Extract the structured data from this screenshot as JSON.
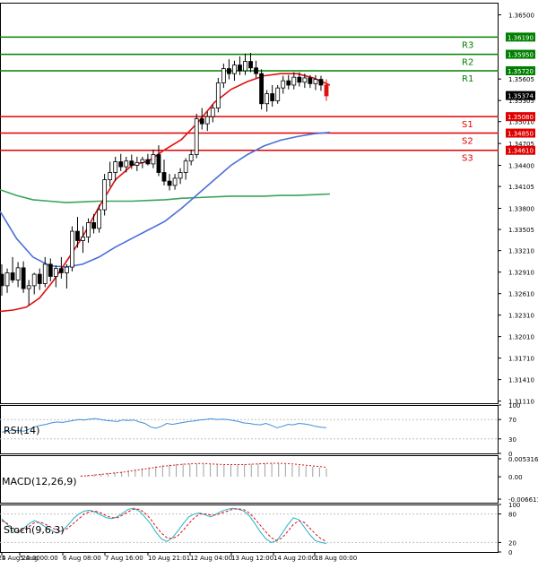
{
  "chart_data": [
    {
      "type": "candlestick",
      "panel": "price",
      "y_ticks": [
        "1.36500",
        "1.35605",
        "1.35305",
        "1.35010",
        "1.34705",
        "1.34400",
        "1.34105",
        "1.33800",
        "1.33505",
        "1.33210",
        "1.32910",
        "1.32610",
        "1.32310",
        "1.32010",
        "1.31710",
        "1.31410",
        "1.31110"
      ],
      "ylim": [
        1.3108,
        1.3667
      ],
      "price_labels": [
        {
          "value": 1.3619,
          "text": "1.36190",
          "color": "#008000"
        },
        {
          "value": 1.3595,
          "text": "1.35950",
          "color": "#008000"
        },
        {
          "value": 1.3572,
          "text": "1.35720",
          "color": "#008000"
        },
        {
          "value": 1.35374,
          "text": "1.35374",
          "color": "#000000"
        },
        {
          "value": 1.3508,
          "text": "1.35080",
          "color": "#e00000"
        },
        {
          "value": 1.3485,
          "text": "1.34850",
          "color": "#e00000"
        },
        {
          "value": 1.3461,
          "text": "1.34610",
          "color": "#e00000"
        }
      ],
      "levels": [
        {
          "name": "R3",
          "value": 1.3619,
          "color": "#008000"
        },
        {
          "name": "R2",
          "value": 1.3595,
          "color": "#008000"
        },
        {
          "name": "R1",
          "value": 1.3572,
          "color": "#008000"
        },
        {
          "name": "S1",
          "value": 1.3508,
          "color": "#e00000"
        },
        {
          "name": "S2",
          "value": 1.3485,
          "color": "#e00000"
        },
        {
          "name": "S3",
          "value": 1.3461,
          "color": "#e00000"
        }
      ],
      "candles": [
        [
          1.3288,
          1.3302,
          1.3258,
          1.3272
        ],
        [
          1.3272,
          1.3296,
          1.3262,
          1.329
        ],
        [
          1.329,
          1.3312,
          1.3276,
          1.328
        ],
        [
          1.328,
          1.3305,
          1.327,
          1.3297
        ],
        [
          1.3297,
          1.3306,
          1.3262,
          1.3268
        ],
        [
          1.3268,
          1.328,
          1.3245,
          1.3272
        ],
        [
          1.3272,
          1.329,
          1.326,
          1.3288
        ],
        [
          1.3288,
          1.3296,
          1.3266,
          1.3275
        ],
        [
          1.3275,
          1.3312,
          1.327,
          1.3302
        ],
        [
          1.3302,
          1.331,
          1.3278,
          1.3285
        ],
        [
          1.3285,
          1.33,
          1.327,
          1.3296
        ],
        [
          1.3296,
          1.3312,
          1.3282,
          1.329
        ],
        [
          1.329,
          1.3302,
          1.3268,
          1.3298
        ],
        [
          1.3298,
          1.3355,
          1.3292,
          1.3348
        ],
        [
          1.3348,
          1.3368,
          1.3325,
          1.3335
        ],
        [
          1.3335,
          1.3355,
          1.3318,
          1.334
        ],
        [
          1.334,
          1.3366,
          1.3332,
          1.336
        ],
        [
          1.336,
          1.3372,
          1.3345,
          1.3352
        ],
        [
          1.3352,
          1.3385,
          1.3346,
          1.3378
        ],
        [
          1.3378,
          1.3428,
          1.337,
          1.342
        ],
        [
          1.342,
          1.3445,
          1.341,
          1.343
        ],
        [
          1.343,
          1.3452,
          1.3418,
          1.3445
        ],
        [
          1.3445,
          1.3456,
          1.3432,
          1.3438
        ],
        [
          1.3438,
          1.3452,
          1.343,
          1.3446
        ],
        [
          1.3446,
          1.3455,
          1.3435,
          1.344
        ],
        [
          1.344,
          1.3452,
          1.3432,
          1.3444
        ],
        [
          1.3444,
          1.3452,
          1.3436,
          1.3448
        ],
        [
          1.3448,
          1.3456,
          1.344,
          1.3442
        ],
        [
          1.3442,
          1.3462,
          1.3436,
          1.3455
        ],
        [
          1.3455,
          1.3468,
          1.3425,
          1.343
        ],
        [
          1.343,
          1.3448,
          1.3412,
          1.3418
        ],
        [
          1.3418,
          1.3428,
          1.3405,
          1.3412
        ],
        [
          1.3412,
          1.3428,
          1.3406,
          1.3422
        ],
        [
          1.3422,
          1.3436,
          1.3414,
          1.343
        ],
        [
          1.343,
          1.345,
          1.342,
          1.3446
        ],
        [
          1.3446,
          1.3462,
          1.344,
          1.3455
        ],
        [
          1.3455,
          1.3512,
          1.345,
          1.3505
        ],
        [
          1.3505,
          1.352,
          1.349,
          1.3498
        ],
        [
          1.3498,
          1.3515,
          1.3488,
          1.3508
        ],
        [
          1.3508,
          1.3525,
          1.35,
          1.352
        ],
        [
          1.352,
          1.3562,
          1.3514,
          1.3555
        ],
        [
          1.3555,
          1.3582,
          1.3548,
          1.3575
        ],
        [
          1.3575,
          1.3588,
          1.356,
          1.3568
        ],
        [
          1.3568,
          1.3586,
          1.3558,
          1.358
        ],
        [
          1.358,
          1.3592,
          1.3566,
          1.3572
        ],
        [
          1.3572,
          1.3596,
          1.3566,
          1.3585
        ],
        [
          1.3585,
          1.3597,
          1.357,
          1.3576
        ],
        [
          1.3576,
          1.3586,
          1.3562,
          1.3568
        ],
        [
          1.3568,
          1.3574,
          1.3518,
          1.3526
        ],
        [
          1.3526,
          1.3545,
          1.3515,
          1.354
        ],
        [
          1.354,
          1.3552,
          1.3522,
          1.353
        ],
        [
          1.353,
          1.3552,
          1.3526,
          1.3548
        ],
        [
          1.3548,
          1.3565,
          1.354,
          1.3558
        ],
        [
          1.3558,
          1.3566,
          1.3546,
          1.3552
        ],
        [
          1.3552,
          1.357,
          1.3546,
          1.3563
        ],
        [
          1.3563,
          1.357,
          1.355,
          1.3556
        ],
        [
          1.3556,
          1.3568,
          1.3548,
          1.3562
        ],
        [
          1.3562,
          1.3566,
          1.3548,
          1.3554
        ],
        [
          1.3554,
          1.3566,
          1.3545,
          1.356
        ],
        [
          1.356,
          1.3565,
          1.3544,
          1.3552
        ],
        [
          1.3552,
          1.356,
          1.353,
          1.3537
        ]
      ],
      "ma_red": [
        [
          0,
          1.3236
        ],
        [
          0.04,
          1.3238
        ],
        [
          0.08,
          1.3242
        ],
        [
          0.12,
          1.3255
        ],
        [
          0.16,
          1.3278
        ],
        [
          0.2,
          1.3305
        ],
        [
          0.25,
          1.334
        ],
        [
          0.3,
          1.3382
        ],
        [
          0.35,
          1.342
        ],
        [
          0.4,
          1.344
        ],
        [
          0.45,
          1.3446
        ],
        [
          0.5,
          1.3462
        ],
        [
          0.55,
          1.3476
        ],
        [
          0.6,
          1.35
        ],
        [
          0.65,
          1.3528
        ],
        [
          0.7,
          1.3546
        ],
        [
          0.75,
          1.3557
        ],
        [
          0.8,
          1.3565
        ],
        [
          0.85,
          1.3568
        ],
        [
          0.9,
          1.3568
        ],
        [
          0.95,
          1.3562
        ],
        [
          1,
          1.3552
        ]
      ],
      "ma_blue": [
        [
          0,
          1.3376
        ],
        [
          0.05,
          1.3338
        ],
        [
          0.1,
          1.3312
        ],
        [
          0.15,
          1.33
        ],
        [
          0.2,
          1.3298
        ],
        [
          0.25,
          1.3302
        ],
        [
          0.3,
          1.3312
        ],
        [
          0.35,
          1.3326
        ],
        [
          0.4,
          1.3338
        ],
        [
          0.45,
          1.335
        ],
        [
          0.5,
          1.3362
        ],
        [
          0.55,
          1.338
        ],
        [
          0.6,
          1.34
        ],
        [
          0.65,
          1.342
        ],
        [
          0.7,
          1.344
        ],
        [
          0.75,
          1.3455
        ],
        [
          0.8,
          1.3467
        ],
        [
          0.85,
          1.3475
        ],
        [
          0.9,
          1.348
        ],
        [
          0.95,
          1.3484
        ],
        [
          1,
          1.3486
        ]
      ],
      "ma_green": [
        [
          0,
          1.3406
        ],
        [
          0.05,
          1.3398
        ],
        [
          0.1,
          1.3392
        ],
        [
          0.15,
          1.339
        ],
        [
          0.2,
          1.3388
        ],
        [
          0.25,
          1.3389
        ],
        [
          0.3,
          1.339
        ],
        [
          0.35,
          1.339
        ],
        [
          0.4,
          1.339
        ],
        [
          0.45,
          1.3391
        ],
        [
          0.5,
          1.3392
        ],
        [
          0.55,
          1.3394
        ],
        [
          0.6,
          1.3395
        ],
        [
          0.65,
          1.3396
        ],
        [
          0.7,
          1.3397
        ],
        [
          0.75,
          1.3397
        ],
        [
          0.8,
          1.3397
        ],
        [
          0.85,
          1.3398
        ],
        [
          0.9,
          1.3398
        ],
        [
          0.95,
          1.3399
        ],
        [
          1,
          1.34
        ]
      ]
    },
    {
      "type": "line",
      "panel": "rsi",
      "label": "RSI(14)",
      "y_ticks": [
        "100",
        "70",
        "30",
        "0"
      ],
      "ylim": [
        0,
        100
      ],
      "values": [
        44,
        46,
        48,
        47,
        46,
        50,
        55,
        58,
        60,
        63,
        65,
        64,
        66,
        68,
        70,
        69,
        71,
        72,
        70,
        68,
        67,
        66,
        69,
        68,
        69,
        65,
        62,
        55,
        52,
        56,
        62,
        60,
        62,
        64,
        66,
        67,
        69,
        70,
        72,
        70,
        71,
        70,
        68,
        66,
        63,
        62,
        60,
        59,
        62,
        58,
        53,
        56,
        60,
        59,
        62,
        61,
        59,
        56,
        54,
        53
      ]
    },
    {
      "type": "histogram",
      "panel": "macd",
      "label": "MACD(12,26,9)",
      "y_ticks": [
        "0.005316",
        "0.00",
        "-0.006611"
      ],
      "ylim": [
        -0.006611,
        0.005316
      ],
      "histogram": [
        0.0003,
        0.0005,
        0.0007,
        0.0009,
        0.0011,
        0.0013,
        0.0016,
        0.0019,
        0.0022,
        0.0025,
        0.0028,
        0.0031,
        0.0034,
        0.0036,
        0.0038,
        0.0039,
        0.0039,
        0.0039,
        0.0038,
        0.0037,
        0.0036,
        0.0035,
        0.0035,
        0.0036,
        0.0037,
        0.0038,
        0.0039,
        0.004,
        0.004,
        0.0039,
        0.0037,
        0.0035,
        0.0033,
        0.0031,
        0.0029,
        0.0027,
        0.0025
      ],
      "signal": [
        0.0002,
        0.0003,
        0.0005,
        0.0007,
        0.0009,
        0.0011,
        0.0013,
        0.0016,
        0.0019,
        0.0022,
        0.0025,
        0.0028,
        0.0031,
        0.0033,
        0.0035,
        0.0037,
        0.0038,
        0.0039,
        0.0039,
        0.0038,
        0.0037,
        0.0036,
        0.0036,
        0.0036,
        0.0036,
        0.0037,
        0.0038,
        0.0039,
        0.004,
        0.004,
        0.0039,
        0.0038,
        0.0036,
        0.0034,
        0.0032,
        0.003,
        0.0028
      ]
    },
    {
      "type": "line",
      "panel": "stoch",
      "label": "Stoch(9,6,3)",
      "y_ticks": [
        "100",
        "80",
        "20",
        "0"
      ],
      "ylim": [
        0,
        100
      ],
      "k": [
        70,
        58,
        44,
        40,
        50,
        60,
        66,
        60,
        52,
        46,
        40,
        45,
        56,
        70,
        80,
        86,
        88,
        84,
        78,
        72,
        70,
        74,
        82,
        90,
        92,
        86,
        74,
        60,
        42,
        28,
        22,
        30,
        44,
        60,
        74,
        80,
        82,
        78,
        74,
        80,
        86,
        90,
        92,
        90,
        86,
        76,
        60,
        42,
        28,
        20,
        24,
        40,
        58,
        72,
        68,
        52,
        36,
        24,
        20,
        18
      ],
      "d": [
        66,
        60,
        50,
        44,
        46,
        54,
        62,
        63,
        58,
        52,
        46,
        44,
        50,
        60,
        70,
        80,
        85,
        86,
        82,
        76,
        72,
        72,
        78,
        85,
        90,
        90,
        82,
        70,
        54,
        40,
        30,
        28,
        34,
        46,
        60,
        72,
        80,
        80,
        78,
        78,
        82,
        86,
        90,
        91,
        89,
        82,
        70,
        56,
        42,
        30,
        24,
        30,
        44,
        58,
        66,
        62,
        50,
        38,
        28,
        22
      ]
    }
  ],
  "x_axis_labels": [
    "4 Aug 2025",
    "4 Aug 20:00",
    "5 Aug 00:00",
    "6 Aug 08:00",
    "7 Aug 16:00",
    "10 Aug 21:01",
    "12 Aug 04:00",
    "13 Aug 12:00",
    "14 Aug 20:00",
    "18 Aug 00:00"
  ]
}
